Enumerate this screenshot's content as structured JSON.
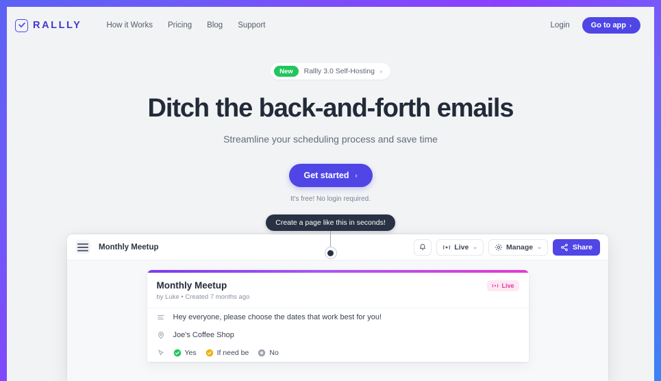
{
  "theme": {
    "accent": "#4f46e5",
    "frame_gradient_from": "#5b62f4",
    "frame_gradient_mid": "#8b3ffc",
    "frame_gradient_to": "#3b82f6",
    "page_bg": "#f1f3f5",
    "badge_green": "#22c55e",
    "live_pink": "#e5399b",
    "card_gradient_from": "#7c3aed",
    "card_gradient_to": "#e23bd0"
  },
  "nav": {
    "brand": "RALLLY",
    "brand_icon": "calendar-check-icon",
    "links": [
      {
        "label": "How it Works"
      },
      {
        "label": "Pricing"
      },
      {
        "label": "Blog"
      },
      {
        "label": "Support"
      }
    ],
    "login_label": "Login",
    "cta_label": "Go to app",
    "cta_chevron": "›"
  },
  "hero": {
    "pill_badge": "New",
    "pill_text": "Rallly 3.0 Self-Hosting",
    "pill_chevron": "›",
    "headline": "Ditch the back-and-forth emails",
    "subheadline": "Streamline your scheduling process and save time",
    "cta_label": "Get started",
    "cta_chevron": "›",
    "note": "It's free! No login required."
  },
  "tooltip": {
    "text": "Create a page like this in seconds!"
  },
  "app": {
    "menu_icon": "hamburger-menu-icon",
    "title": "Monthly Meetup",
    "toolbar": {
      "notify_icon": "bell-icon",
      "live_label": "Live",
      "live_icon": "live-indicator-icon",
      "manage_label": "Manage",
      "manage_icon": "gear-icon",
      "chevron": "⌄",
      "share_label": "Share",
      "share_icon": "share-nodes-icon"
    },
    "poll": {
      "title": "Monthly Meetup",
      "meta": "by Luke • Created 7 months ago",
      "live_badge": "Live",
      "description_icon": "align-left-icon",
      "description": "Hey everyone, please choose the dates that work best for you!",
      "location_icon": "map-pin-icon",
      "location": "Joe's Coffee Shop",
      "legend_icon": "cursor-click-icon",
      "legend": [
        {
          "label": "Yes",
          "color": "#22c55e",
          "icon": "check-circle-icon"
        },
        {
          "label": "If need be",
          "color": "#eab308",
          "icon": "check-circle-icon"
        },
        {
          "label": "No",
          "color": "#9ca3af",
          "icon": "x-circle-icon"
        }
      ]
    }
  }
}
